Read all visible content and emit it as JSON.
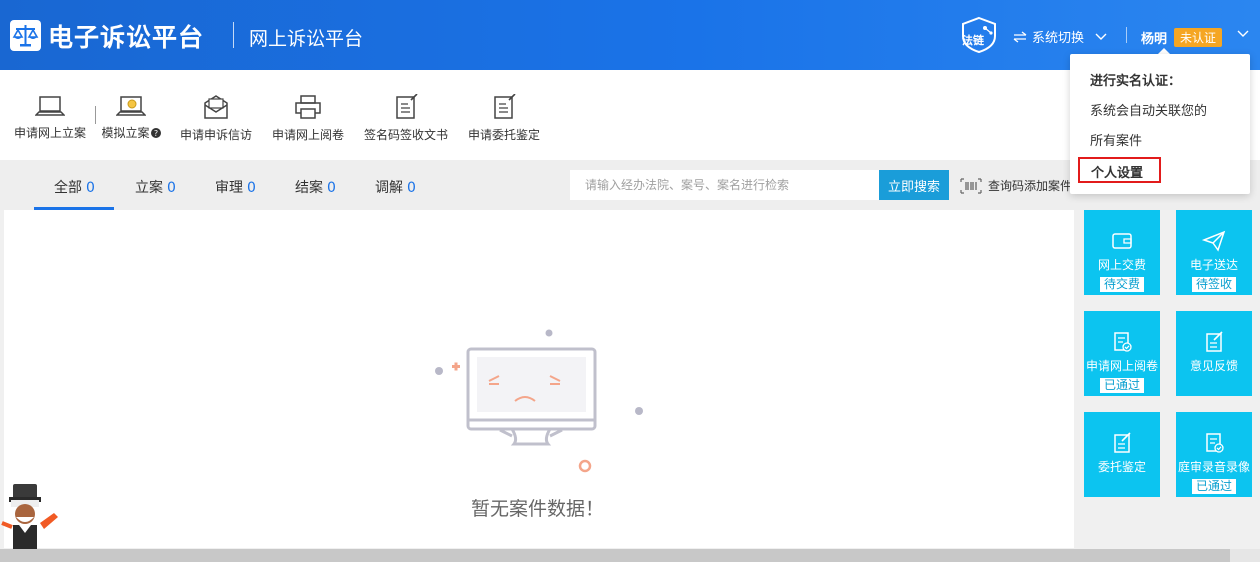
{
  "header": {
    "brand": "电子诉讼平台",
    "sub_brand": "网上诉讼平台",
    "fachain_label": "法链",
    "system_switch": "系统切换",
    "user_name": "杨明",
    "verify_badge": "未认证"
  },
  "toolbar": {
    "items": [
      {
        "label": "申请网上立案",
        "icon": "laptop-icon"
      },
      {
        "label": "模拟立案",
        "icon": "laptop-coin-icon",
        "help_icon": "question-icon"
      },
      {
        "label": "申请申诉信访",
        "icon": "envelope-icon"
      },
      {
        "label": "申请网上阅卷",
        "icon": "printer-icon"
      },
      {
        "label": "签名码签收文书",
        "icon": "edit-document-icon"
      },
      {
        "label": "申请委托鉴定",
        "icon": "edit-document-icon"
      }
    ]
  },
  "tabs": [
    {
      "label": "全部",
      "count": "0",
      "active": true
    },
    {
      "label": "立案",
      "count": "0"
    },
    {
      "label": "审理",
      "count": "0"
    },
    {
      "label": "结案",
      "count": "0"
    },
    {
      "label": "调解",
      "count": "0"
    }
  ],
  "search": {
    "placeholder": "请输入经办法院、案号、案名进行检索",
    "button": "立即搜索",
    "qr_add": "查询码添加案件"
  },
  "empty": {
    "text": "暂无案件数据！"
  },
  "tiles": [
    {
      "label": "网上交费",
      "status": "待交费",
      "icon": "wallet-icon"
    },
    {
      "label": "电子送达",
      "status": "待签收",
      "icon": "paper-plane-icon"
    },
    {
      "label": "申请网上阅卷",
      "status": "已通过",
      "icon": "document-check-icon"
    },
    {
      "label": "意见反馈",
      "icon": "edit-icon"
    },
    {
      "label": "委托鉴定",
      "icon": "edit-icon"
    },
    {
      "label": "庭审录音录像",
      "status": "已通过",
      "icon": "document-check-icon"
    }
  ],
  "dropdown": {
    "title": "进行实名认证：",
    "line1": "系统会自动关联您的",
    "line2": "所有案件",
    "settings": "个人设置"
  },
  "colors": {
    "header_blue": "#1a73e8",
    "tile_cyan": "#0cc4f0",
    "badge_orange": "#f5a623",
    "highlight_red": "#e21b1b"
  }
}
